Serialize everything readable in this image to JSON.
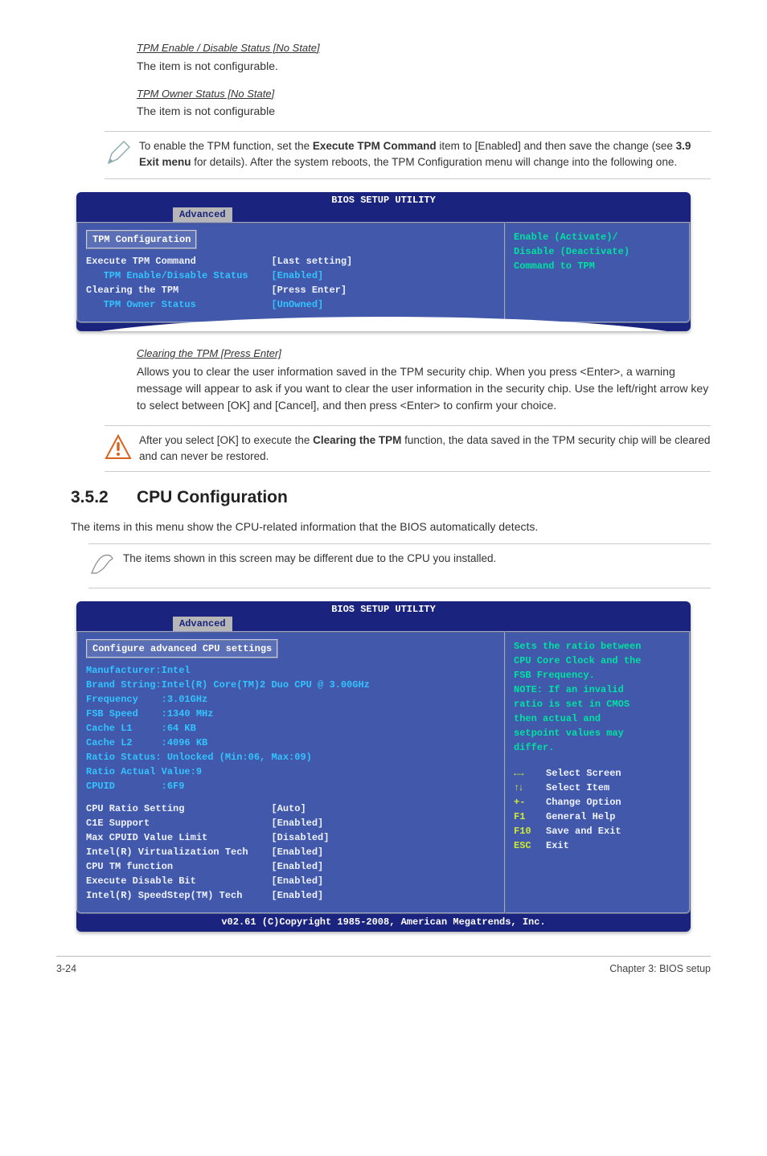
{
  "sec1": {
    "head": "TPM Enable / Disable Status [No State]",
    "body": "The item is not configurable."
  },
  "sec2": {
    "head": "TPM Owner Status [No State]",
    "body": "The item is not configurable"
  },
  "note1": "To enable the TPM function, set the <b>Execute TPM Command</b> item to [Enabled] and then save the change (see <b>3.9 Exit menu</b> for details). After the system reboots, the TPM Configuration menu will change into the following one.",
  "bios1": {
    "title": "BIOS SETUP UTILITY",
    "tab": "Advanced",
    "boxTitle": "TPM Configuration",
    "lines": [
      {
        "k": "Execute TPM Command",
        "kcls": "k",
        "v": "[Last setting]",
        "vcls": "v"
      },
      {
        "k": "   TPM Enable/Disable Status",
        "kcls": "kblue",
        "v": "[Enabled]",
        "vcls": "vblue"
      },
      {
        "k": "Clearing the TPM",
        "kcls": "k",
        "v": "[Press Enter]",
        "vcls": "v"
      },
      {
        "k": "   TPM Owner Status",
        "kcls": "kblue",
        "v": "[UnOwned]",
        "vcls": "vblue"
      }
    ],
    "help": "Enable (Activate)/\nDisable (Deactivate)\nCommand to TPM"
  },
  "sec3": {
    "head": "Clearing the TPM [Press Enter]",
    "body": "Allows you to clear the user information saved in the TPM security chip. When you press <Enter>, a warning message will appear to ask if you want to clear the user information in the security chip. Use the left/right arrow key to select between [OK] and [Cancel], and then press <Enter> to confirm your choice."
  },
  "note2": "After you select [OK] to execute the <b>Clearing the TPM</b> function, the data saved in the TPM security chip will be cleared and can never be restored.",
  "h2": {
    "num": "3.5.2",
    "text": "CPU Configuration"
  },
  "intro": "The items in this menu show the CPU-related information that the BIOS automatically detects.",
  "note3": "The items shown in this screen may be different due to the CPU you installed.",
  "bios2": {
    "title": "BIOS SETUP UTILITY",
    "tab": "Advanced",
    "boxTitle": "Configure advanced CPU settings",
    "chart_data": {
      "type": "table",
      "static_info": [
        "Manufacturer:Intel",
        "Brand String:Intel(R) Core(TM)2 Duo CPU @ 3.00GHz",
        "Frequency    :3.01GHz",
        "FSB Speed    :1340 MHz",
        "Cache L1     :64 KB",
        "Cache L2     :4096 KB",
        "Ratio Status: Unlocked (Min:06, Max:09)",
        "Ratio Actual Value:9",
        "CPUID        :6F9"
      ],
      "settings": [
        {
          "name": "CPU Ratio Setting",
          "value": "[Auto]"
        },
        {
          "name": "C1E Support",
          "value": "[Enabled]"
        },
        {
          "name": "Max CPUID Value Limit",
          "value": "[Disabled]"
        },
        {
          "name": "Intel(R) Virtualization Tech",
          "value": "[Enabled]"
        },
        {
          "name": "CPU TM function",
          "value": "[Enabled]"
        },
        {
          "name": "Execute Disable Bit",
          "value": "[Enabled]"
        },
        {
          "name": "Intel(R) SpeedStep(TM) Tech",
          "value": "[Enabled]"
        }
      ]
    },
    "helpTop": "Sets the ratio between\nCPU Core Clock and the\nFSB Frequency.\nNOTE: If an invalid\nratio is set in CMOS\nthen actual and\nsetpoint values may\ndiffer.",
    "keys": [
      {
        "icon": "lr",
        "label": "Select Screen"
      },
      {
        "icon": "ud",
        "label": "Select Item"
      },
      {
        "icon": "+-",
        "label": "Change Option"
      },
      {
        "icon": "F1",
        "label": "General Help"
      },
      {
        "icon": "F10",
        "label": "Save and Exit"
      },
      {
        "icon": "ESC",
        "label": "Exit"
      }
    ],
    "footer": "v02.61 (C)Copyright 1985-2008, American Megatrends, Inc."
  },
  "pgfooter": {
    "left": "3-24",
    "right": "Chapter 3: BIOS setup"
  }
}
